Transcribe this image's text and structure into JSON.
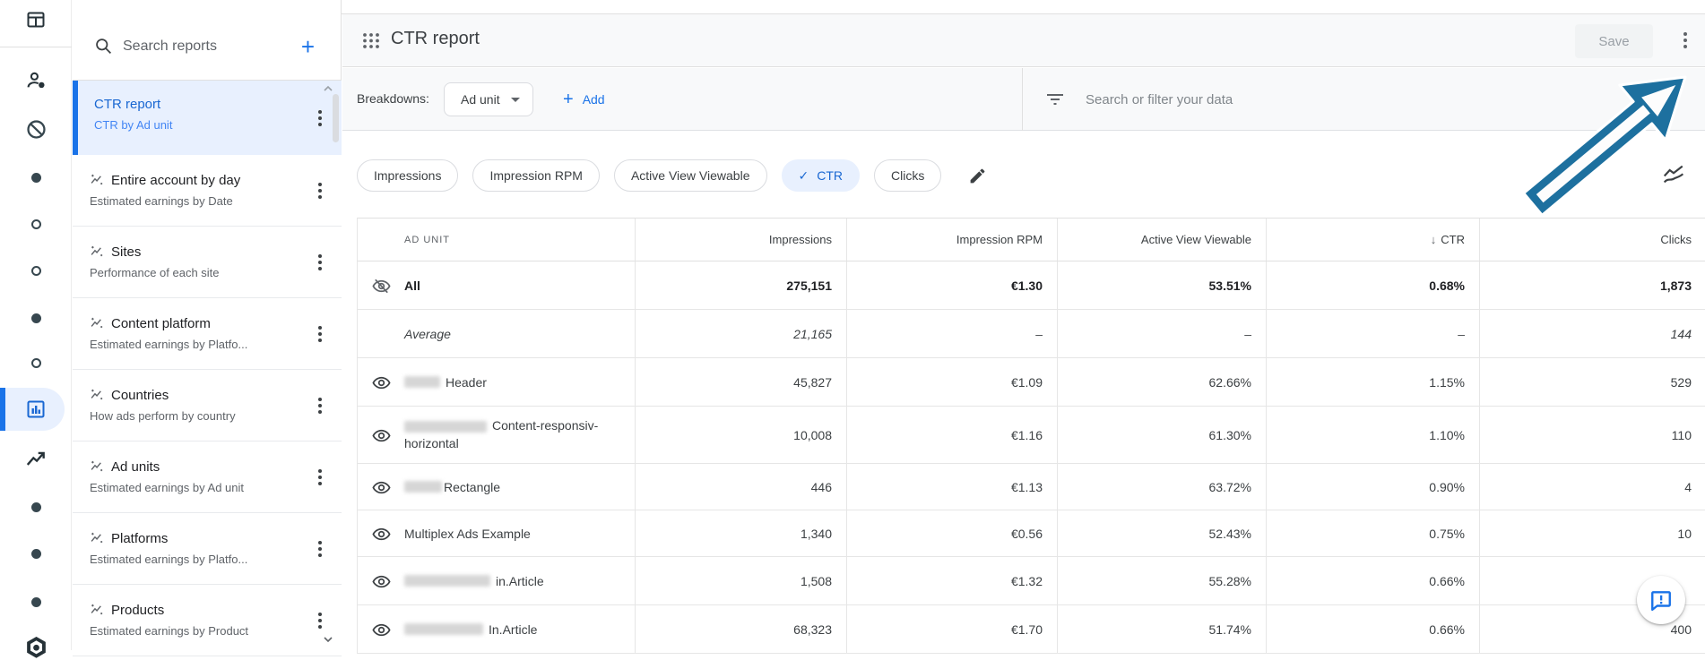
{
  "colors": {
    "accent": "#1a73e8",
    "selected_bg": "#e8f0fe",
    "selected_text": "#1967d2",
    "annotation_arrow": "#1d709f",
    "disabled_button_bg": "#f1f3f4",
    "border": "#e0e0e0"
  },
  "rail": {
    "icons": [
      "home-layout-icon",
      "account-icon",
      "blocking-icon",
      "nav-dot-icon",
      "nav-dot-icon",
      "nav-dot-icon",
      "nav-dot-icon",
      "nav-dot-icon",
      "reports-icon(selected)",
      "trends-icon",
      "nav-dot-icon",
      "nav-dot-icon",
      "nav-dot-icon",
      "settings-icon(partial)"
    ]
  },
  "sidebar": {
    "search_placeholder": "Search reports",
    "add_icon": "plus-icon",
    "reports": [
      {
        "title": "CTR report",
        "subtitle": "CTR by Ad unit",
        "selected": true
      },
      {
        "title": "Entire account by day",
        "subtitle": "Estimated earnings by Date"
      },
      {
        "title": "Sites",
        "subtitle": "Performance of each site"
      },
      {
        "title": "Content platform",
        "subtitle": "Estimated earnings by Platfo..."
      },
      {
        "title": "Countries",
        "subtitle": "How ads perform by country"
      },
      {
        "title": "Ad units",
        "subtitle": "Estimated earnings by Ad unit"
      },
      {
        "title": "Platforms",
        "subtitle": "Estimated earnings by Platfo..."
      },
      {
        "title": "Products",
        "subtitle": "Estimated earnings by Product"
      }
    ]
  },
  "header": {
    "title": "CTR report",
    "save_label": "Save"
  },
  "toolbar": {
    "breakdowns_label": "Breakdowns:",
    "breakdown_value": "Ad unit",
    "add_label": "Add",
    "filter_placeholder": "Search or filter your data"
  },
  "chips": [
    {
      "label": "Impressions",
      "selected": false
    },
    {
      "label": "Impression RPM",
      "selected": false
    },
    {
      "label": "Active View Viewable",
      "selected": false
    },
    {
      "label": "CTR",
      "selected": true,
      "check_glyph": "✓"
    },
    {
      "label": "Clicks",
      "selected": false
    }
  ],
  "table": {
    "columns": [
      "AD UNIT",
      "Impressions",
      "Impression RPM",
      "Active View Viewable",
      "CTR",
      "Clicks"
    ],
    "sort": {
      "column": "CTR",
      "direction": "desc",
      "glyph": "↓"
    },
    "rows": [
      {
        "name": "All",
        "icon": "visibility-off-icon",
        "style": "bold",
        "values": [
          "275,151",
          "€1.30",
          "53.51%",
          "0.68%",
          "1,873"
        ]
      },
      {
        "name": "Average",
        "icon": null,
        "style": "italic",
        "values": [
          "21,165",
          "–",
          "–",
          "–",
          "144"
        ]
      },
      {
        "name": "Header",
        "redacted_prefix": true,
        "icon": "visibility-icon",
        "values": [
          "45,827",
          "€1.09",
          "62.66%",
          "1.15%",
          "529"
        ]
      },
      {
        "name": "Content-responsiv-horizontal",
        "redacted_prefix": true,
        "icon": "visibility-icon",
        "values": [
          "10,008",
          "€1.16",
          "61.30%",
          "1.10%",
          "110"
        ]
      },
      {
        "name": "Rectangle",
        "redacted_prefix": true,
        "icon": "visibility-icon",
        "values": [
          "446",
          "€1.13",
          "63.72%",
          "0.90%",
          "4"
        ]
      },
      {
        "name": "Multiplex Ads Example",
        "redacted_prefix": false,
        "icon": "visibility-icon",
        "values": [
          "1,340",
          "€0.56",
          "52.43%",
          "0.75%",
          "10"
        ]
      },
      {
        "name": "in.Article",
        "redacted_prefix": true,
        "icon": "visibility-icon",
        "values": [
          "1,508",
          "€1.32",
          "55.28%",
          "0.66%",
          ""
        ]
      },
      {
        "name": "In.Article",
        "redacted_prefix": true,
        "icon": "visibility-icon",
        "values": [
          "68,323",
          "€1.70",
          "51.74%",
          "0.66%",
          "400"
        ]
      }
    ]
  },
  "fab": {
    "icon": "feedback-icon"
  }
}
